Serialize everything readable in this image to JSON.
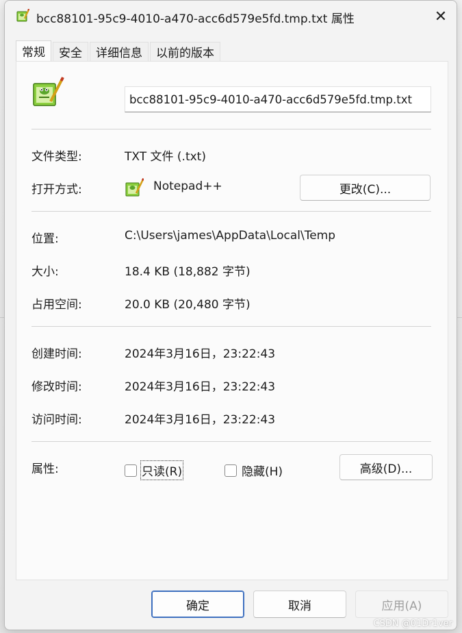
{
  "window": {
    "title": "bcc88101-95c9-4010-a470-acc6d579e5fd.tmp.txt 属性",
    "close_glyph": "✕"
  },
  "tabs": [
    {
      "label": "常规",
      "active": true
    },
    {
      "label": "安全",
      "active": false
    },
    {
      "label": "详细信息",
      "active": false
    },
    {
      "label": "以前的版本",
      "active": false
    }
  ],
  "general": {
    "filename": "bcc88101-95c9-4010-a470-acc6d579e5fd.tmp.txt",
    "file_type_label": "文件类型:",
    "file_type_value": "TXT 文件 (.txt)",
    "open_with_label": "打开方式:",
    "open_with_value": "Notepad++",
    "change_button": "更改(C)...",
    "location_label": "位置:",
    "location_value": "C:\\Users\\james\\AppData\\Local\\Temp",
    "size_label": "大小:",
    "size_value": "18.4 KB (18,882 字节)",
    "size_on_disk_label": "占用空间:",
    "size_on_disk_value": "20.0 KB (20,480 字节)",
    "created_label": "创建时间:",
    "created_value": "2024年3月16日，23:22:43",
    "modified_label": "修改时间:",
    "modified_value": "2024年3月16日，23:22:43",
    "accessed_label": "访问时间:",
    "accessed_value": "2024年3月16日，23:22:43",
    "attributes_label": "属性:",
    "readonly_label": "只读(R)",
    "readonly_checked": false,
    "hidden_label": "隐藏(H)",
    "hidden_checked": false,
    "advanced_button": "高级(D)..."
  },
  "footer": {
    "ok": "确定",
    "cancel": "取消",
    "apply": "应用(A)"
  },
  "watermark": "CSDN @01Dr1ver",
  "icons": {
    "file_icon": "notepad-plus-plus-icon",
    "app_icon": "notepad-plus-plus-icon"
  },
  "colors": {
    "accent": "#3d6fbf",
    "disabled_text": "#a0a0a0"
  }
}
